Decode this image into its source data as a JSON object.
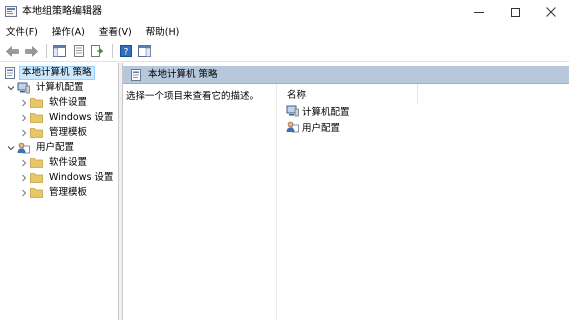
{
  "window": {
    "title": "本地组策略编辑器"
  },
  "menu": [
    {
      "label": "文件(F)"
    },
    {
      "label": "操作(A)"
    },
    {
      "label": "查看(V)"
    },
    {
      "label": "帮助(H)"
    }
  ],
  "tree": {
    "root": "本地计算机 策略",
    "computer": {
      "label": "计算机配置",
      "children": [
        "软件设置",
        "Windows 设置",
        "管理模板"
      ]
    },
    "user": {
      "label": "用户配置",
      "children": [
        "软件设置",
        "Windows 设置",
        "管理模板"
      ]
    }
  },
  "detail": {
    "header": "本地计算机 策略",
    "description": "选择一个项目来查看它的描述。",
    "column_name": "名称",
    "items": [
      "计算机配置",
      "用户配置"
    ]
  },
  "colors": {
    "header_bar": "#b7c7dc",
    "selection": "#cce8ff",
    "folder": "#e8c66a"
  }
}
